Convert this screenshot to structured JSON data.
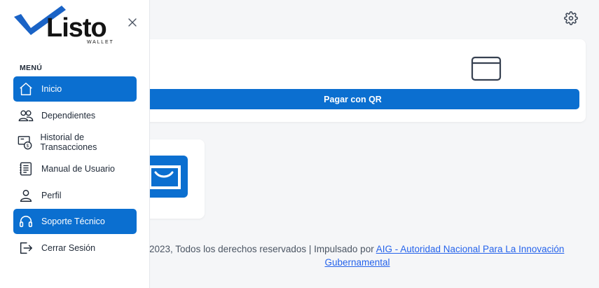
{
  "app": {
    "logo_text": "Listo",
    "logo_subtext": "WALLET"
  },
  "colors": {
    "primary": "#0b6fd0",
    "logo_check": "#1a63c6",
    "text": "#1f2937",
    "link": "#2563eb"
  },
  "drawer": {
    "menu_label": "MENÚ",
    "items": [
      {
        "label": "Inicio",
        "icon": "home-icon",
        "active": true
      },
      {
        "label": "Dependientes",
        "icon": "users-icon",
        "active": false
      },
      {
        "label": "Historial de Transacciones",
        "icon": "transaction-history-icon",
        "active": false
      },
      {
        "label": "Manual de Usuario",
        "icon": "manual-icon",
        "active": false
      },
      {
        "label": "Perfil",
        "icon": "user-icon",
        "active": false
      },
      {
        "label": "Soporte Técnico",
        "icon": "headset-icon",
        "active": true
      },
      {
        "label": "Cerrar Sesión",
        "icon": "logout-icon",
        "active": false
      }
    ]
  },
  "main": {
    "qr_card": {
      "button_label": "Pagar con QR",
      "icon": "wallet-outline-icon"
    },
    "small_card": {
      "icon": "wallet-filled-icon"
    }
  },
  "footer": {
    "text": "2023, Todos los derechos reservados | Impulsado por ",
    "link_part1": "AIG - Autoridad Nacional Para La Innovación",
    "link_part2": "Gubernamental"
  }
}
